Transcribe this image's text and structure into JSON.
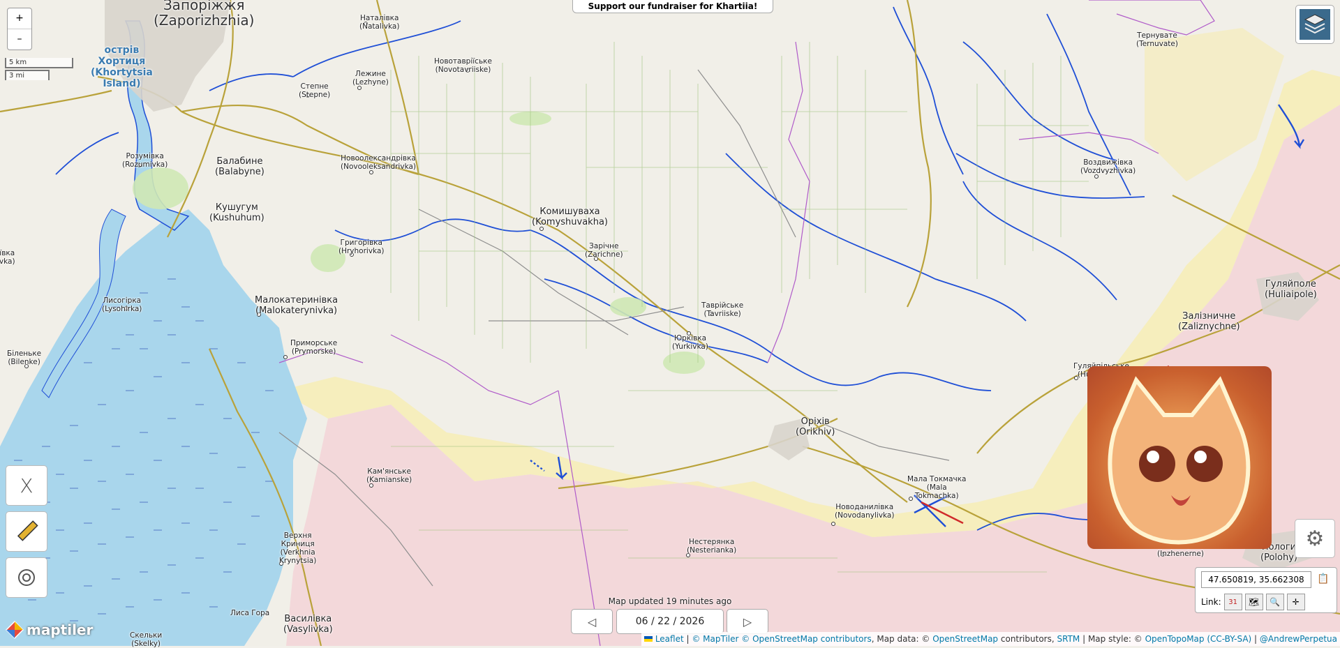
{
  "banner": {
    "text": "Support our fundraiser for Khartiia!"
  },
  "zoom": {
    "in_label": "+",
    "out_label": "–"
  },
  "scale": {
    "km": "5 km",
    "mi": "3 mi"
  },
  "tools": {
    "x_label": "X",
    "ruler_icon": "ruler-icon",
    "target_icon": "target-icon"
  },
  "places": [
    {
      "name": "Запоріжжя\n(Zaporizhzhia)",
      "size": "huge"
    },
    {
      "name": "острів\nХортиця\n(Khortytsia\nIsland)",
      "size": "island"
    },
    {
      "name": "Наталівка\n(Natalivka)"
    },
    {
      "name": "Новотавріїське\n(Novotavriiske)"
    },
    {
      "name": "Лежине\n(Lezhyne)"
    },
    {
      "name": "Степне\n(Stepne)"
    },
    {
      "name": "Розумівка\n(Rozumivka)"
    },
    {
      "name": "Балабине\n(Balabyne)",
      "size": "big"
    },
    {
      "name": "Новоолександрівка\n(Novooleksandrivka)"
    },
    {
      "name": "Кушугум\n(Kushuhum)",
      "size": "big"
    },
    {
      "name": "Комишуваха\n(Komyshuvakha)",
      "size": "big"
    },
    {
      "name": "Зарічне\n(Zarichne)"
    },
    {
      "name": "Григорівка\n(Hryhorivka)"
    },
    {
      "name": "Малокатеринівка\n(Malokaterynivka)",
      "size": "big"
    },
    {
      "name": "Лисогірка\n(Lysohirka)"
    },
    {
      "name": "Приморське\n(Prymorske)"
    },
    {
      "name": "Біленьке\n(Bilenke)"
    },
    {
      "name": "Таврійське\n(Tavriiske)"
    },
    {
      "name": "Юрківка\n(Yurkivka)"
    },
    {
      "name": "Оріхів\n(Orikhiv)",
      "size": "big"
    },
    {
      "name": "Кам'янське\n(Kamianske)"
    },
    {
      "name": "Мала Токмачка\n(Mala\nTokmachka)"
    },
    {
      "name": "Новоданилівка\n(Novodanylivka)"
    },
    {
      "name": "Нестерянка\n(Nesterianka)"
    },
    {
      "name": "Верхня\nКриниця\n(Verkhnia\nKrynytsia)"
    },
    {
      "name": "Василівка\n(Vasylivka)",
      "size": "big"
    },
    {
      "name": "Лиса Гора"
    },
    {
      "name": "Скельки\n(Skelky)"
    },
    {
      "name": "Тернувате\n(Ternuvate)"
    },
    {
      "name": "Воздвижівка\n(Vozdvyzhivka)"
    },
    {
      "name": "Гуляйполе\n(Huliaipole)",
      "size": "big"
    },
    {
      "name": "Залізничне\n(Zaliznychne)",
      "size": "big"
    },
    {
      "name": "Гуляйпільське\n(Huliaipilske)"
    },
    {
      "name": "Інженерне\n(Inzhenerne)"
    },
    {
      "name": "Пологи\n(Polohy)",
      "size": "big"
    },
    {
      "name": "'ївка\nivka)"
    }
  ],
  "colors": {
    "river": "#1f4fd6",
    "water": "#a9d3ea",
    "occupied": "#f4d6d6",
    "contested": "#f3ecb5",
    "road": "#b9a23a",
    "accent": "#0078a8"
  },
  "coords": {
    "value": "47.650819, 35.662308",
    "copy_icon": "clipboard-icon"
  },
  "link": {
    "label": "Link:",
    "icons": [
      "calendar-icon",
      "map-icon",
      "search-icon",
      "crosshair-icon"
    ],
    "calendar_day": "31"
  },
  "updated": {
    "text": "Map updated 19 minutes ago"
  },
  "date": {
    "value": "06 / 22 / 2026"
  },
  "nav": {
    "prev": "◁",
    "next": "▷"
  },
  "attribution": {
    "leaflet": "Leaflet",
    "maptiler": "© MapTiler",
    "osm": "© OpenStreetMap contributors",
    "mapdata": ", Map data: ©",
    "osm2": "OpenStreetMap",
    "contributors": "contributors,",
    "srtm": "SRTM",
    "style": "| Map style: ©",
    "opentopo": "OpenTopoMap (CC-BY-SA)",
    "author": "@AndrewPerpetua"
  },
  "logo": {
    "text": "maptiler"
  },
  "overlay_image": {
    "description_icon": "cat-avatar-icon"
  }
}
